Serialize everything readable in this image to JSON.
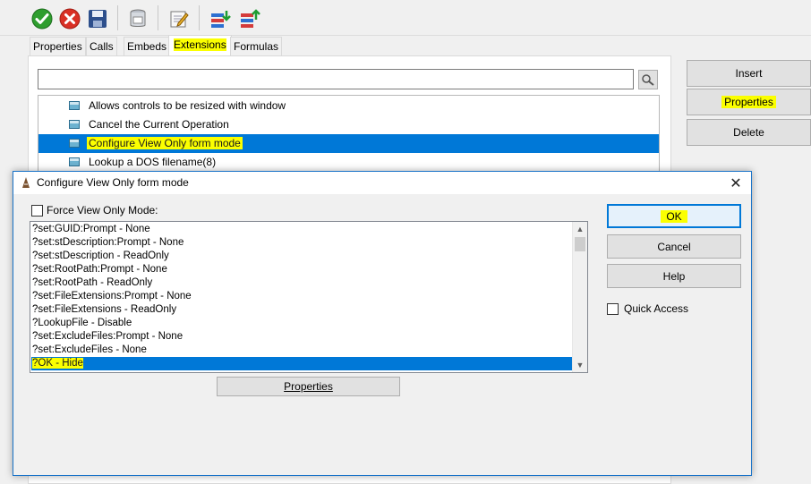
{
  "toolbar": {
    "buttons": [
      {
        "name": "ok-check-icon"
      },
      {
        "name": "cancel-x-icon"
      },
      {
        "name": "save-disk-icon"
      },
      {
        "name": "database-icon"
      },
      {
        "name": "edit-note-icon"
      },
      {
        "name": "import-icon"
      },
      {
        "name": "export-icon"
      }
    ]
  },
  "tabs": [
    {
      "label": "Properties"
    },
    {
      "label": "Calls"
    },
    {
      "label": "Embeds"
    },
    {
      "label": "Extensions"
    },
    {
      "label": "Formulas"
    }
  ],
  "search": {
    "value": ""
  },
  "extensions": [
    {
      "label": "Allows controls to be resized with window"
    },
    {
      "label": "Cancel the Current Operation"
    },
    {
      "label": "Configure View Only form mode"
    },
    {
      "label": "Lookup a DOS filename(8)"
    }
  ],
  "side_buttons": {
    "insert": "Insert",
    "properties": "Properties",
    "delete": "Delete"
  },
  "dialog": {
    "title": "Configure View Only form mode",
    "force_label": "Force View Only Mode:",
    "force_checked": false,
    "items": [
      "?set:GUID:Prompt - None",
      "?set:stDescription:Prompt - None",
      "?set:stDescription - ReadOnly",
      "?set:RootPath:Prompt - None",
      "?set:RootPath - ReadOnly",
      "?set:FileExtensions:Prompt - None",
      "?set:FileExtensions - ReadOnly",
      "?LookupFile - Disable",
      "?set:ExcludeFiles:Prompt - None",
      "?set:ExcludeFiles - None",
      "?OK - Hide"
    ],
    "properties_button": "Properties",
    "ok_button": "OK",
    "cancel_button": "Cancel",
    "help_button": "Help",
    "quick_access_label": "Quick Access",
    "quick_access_checked": false
  },
  "colors": {
    "accent": "#0078d7",
    "highlight": "#fbff00"
  }
}
